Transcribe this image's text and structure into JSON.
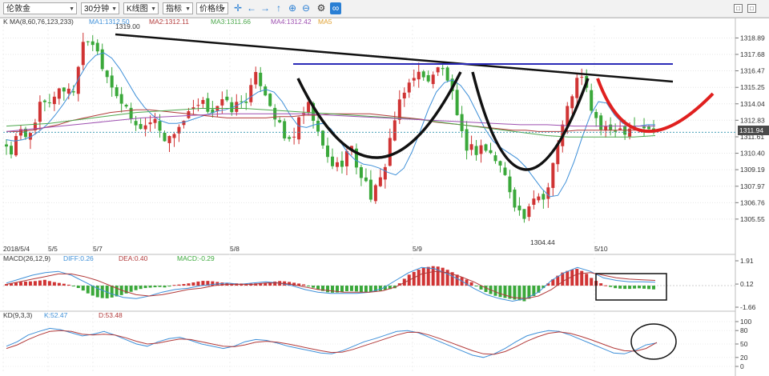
{
  "toolbar": {
    "symbol": "伦敦金",
    "period": "30分钟",
    "chart_type": "K线图",
    "indicator": "指标",
    "line_type": "价格线",
    "icons": [
      "crosshair-icon",
      "arrow-left-icon",
      "arrow-right-icon",
      "arrow-up-icon",
      "zoom-in-icon",
      "zoom-out-icon",
      "settings-icon",
      "link-icon"
    ]
  },
  "colors": {
    "up": "#d03434",
    "down": "#3aa83a",
    "ma1": "#3d8fd8",
    "ma2": "#b23a3a",
    "ma3": "#4da84d",
    "ma4": "#9d4fb0",
    "ma5": "#e0a030",
    "diff": "#3d8fd8",
    "dea": "#b23a3a",
    "k": "#3d8fd8",
    "d": "#b23a3a",
    "trend_black": "#111111",
    "resistance_blue": "#2b2bb8",
    "projection_red": "#e0201f",
    "last_price_bg": "#4a4a4a"
  },
  "main_legend": {
    "prefix": "K   MA(8,60,76,123,233)",
    "ma1": "MA1:1312.50",
    "ma2": "MA2:1312.11",
    "ma3": "MA3:1311.66",
    "ma4": "MA4:1312.42",
    "ma5": "MA5"
  },
  "macd_legend": {
    "prefix": "MACD(26,12,9)",
    "diff": "DIFF:0.26",
    "dea": "DEA:0.40",
    "macd": "MACD:-0.29"
  },
  "kd_legend": {
    "prefix": "KD(9,3,3)",
    "k": "K:52.47",
    "d": "D:53.48"
  },
  "annotations": {
    "high": "1319.00",
    "low": "1304.44",
    "last_price": "1311.94"
  },
  "chart_data": [
    {
      "type": "candlestick",
      "title": "",
      "y_ticks": [
        "1318.89",
        "1317.68",
        "1316.47",
        "1315.25",
        "1314.04",
        "1312.83",
        "1311.61",
        "1310.40",
        "1309.19",
        "1307.97",
        "1306.76",
        "1305.55"
      ],
      "ylim": [
        1304.6,
        1319.8
      ],
      "x_labels": [
        "2018/5/4",
        "5/5",
        "5/7",
        "5/8",
        "5/9",
        "5/10"
      ],
      "high_label": 1319.0,
      "low_label": 1304.44,
      "last_price": 1311.94,
      "close_path": [
        1311.0,
        1310.4,
        1311.6,
        1312.0,
        1311.2,
        1312.6,
        1313.4,
        1314.2,
        1313.6,
        1314.6,
        1315.4,
        1314.9,
        1315.3,
        1314.9,
        1317.6,
        1318.6,
        1319.0,
        1318.2,
        1317.4,
        1316.4,
        1315.6,
        1315.0,
        1314.2,
        1313.4,
        1312.8,
        1312.2,
        1312.5,
        1312.4,
        1313.0,
        1312.6,
        1311.8,
        1311.2,
        1312.0,
        1312.4,
        1312.8,
        1313.2,
        1313.6,
        1313.8,
        1314.0,
        1313.5,
        1313.8,
        1314.2,
        1314.0,
        1313.7,
        1313.9,
        1314.2,
        1314.5,
        1315.2,
        1316.2,
        1315.4,
        1314.6,
        1313.6,
        1312.6,
        1311.6,
        1311.2,
        1311.8,
        1312.6,
        1313.4,
        1313.8,
        1312.6,
        1311.4,
        1310.4,
        1309.8,
        1309.4,
        1309.6,
        1310.4,
        1310.8,
        1309.6,
        1308.8,
        1308.0,
        1307.2,
        1307.8,
        1308.6,
        1310.6,
        1312.4,
        1313.6,
        1314.6,
        1315.4,
        1316.3,
        1316.2,
        1315.8,
        1316.0,
        1316.4,
        1316.6,
        1316.4,
        1315.4,
        1313.4,
        1311.8,
        1311.0,
        1310.8,
        1310.6,
        1311.0,
        1310.6,
        1310.2,
        1309.8,
        1309.2,
        1308.2,
        1307.2,
        1306.2,
        1305.6,
        1306.0,
        1306.8,
        1307.4,
        1307.0,
        1308.6,
        1310.2,
        1311.6,
        1313.0,
        1314.4,
        1315.6,
        1316.0,
        1315.2,
        1313.8,
        1312.8,
        1312.2,
        1311.9,
        1312.2,
        1312.4,
        1312.1,
        1312.3,
        1312.6,
        1312.2,
        1312.4,
        1312.0,
        1311.9
      ],
      "ma_series": [
        {
          "name": "MA1",
          "values": [
            1311.4,
            1311.3,
            1311.4,
            1311.6,
            1312.0,
            1312.5,
            1313.2,
            1314.0,
            1314.9,
            1316.0,
            1317.0,
            1317.6,
            1317.8,
            1317.4,
            1316.6,
            1315.6,
            1314.6,
            1313.8,
            1313.2,
            1312.8,
            1312.6,
            1312.6,
            1312.7,
            1312.9,
            1313.1,
            1313.3,
            1313.5,
            1313.6,
            1313.8,
            1314.1,
            1314.5,
            1314.9,
            1315.1,
            1314.9,
            1314.2,
            1313.2,
            1312.4,
            1312.3,
            1312.5,
            1312.6,
            1312.2,
            1311.4,
            1310.5,
            1309.9,
            1309.6,
            1309.5,
            1309.3,
            1309.0,
            1308.8,
            1309.3,
            1310.5,
            1312.0,
            1313.6,
            1314.9,
            1315.6,
            1315.8,
            1315.4,
            1314.6,
            1313.4,
            1312.2,
            1311.3,
            1310.8,
            1310.4,
            1310.0,
            1309.4,
            1308.6,
            1307.8,
            1307.2,
            1307.3,
            1308.3,
            1309.8,
            1311.6,
            1313.2,
            1314.2,
            1314.1,
            1313.2,
            1312.6,
            1312.4,
            1312.4,
            1312.5,
            1312.5
          ]
        },
        {
          "name": "MA2",
          "values": [
            1312.0,
            1312.0,
            1312.1,
            1312.3,
            1312.5,
            1312.8,
            1313.0,
            1313.2,
            1313.4,
            1313.5,
            1313.6,
            1313.6,
            1313.5,
            1313.4,
            1313.3,
            1313.2,
            1313.1,
            1313.0,
            1313.0,
            1313.0,
            1313.0,
            1313.1,
            1313.1,
            1313.2,
            1313.2,
            1313.3,
            1313.3,
            1313.3,
            1313.3,
            1313.2,
            1313.1,
            1313.0,
            1312.9,
            1312.7,
            1312.6,
            1312.5,
            1312.4,
            1312.3,
            1312.2,
            1312.1,
            1312.1,
            1312.0,
            1312.0,
            1312.0,
            1312.1,
            1312.1,
            1312.1,
            1312.1,
            1312.1,
            1312.1,
            1312.1
          ]
        },
        {
          "name": "MA3",
          "values": [
            1312.4,
            1312.5,
            1312.6,
            1312.8,
            1313.0,
            1313.2,
            1313.4,
            1313.5,
            1313.6,
            1313.7,
            1313.7,
            1313.7,
            1313.6,
            1313.5,
            1313.4,
            1313.3,
            1313.2,
            1313.1,
            1313.0,
            1312.9,
            1312.7,
            1312.5,
            1312.3,
            1312.1,
            1311.9,
            1311.7,
            1311.6,
            1311.6,
            1311.6,
            1311.6,
            1311.7
          ]
        },
        {
          "name": "MA4",
          "values": [
            1312.0,
            1312.2,
            1312.4,
            1312.6,
            1312.8,
            1313.0,
            1313.1,
            1313.2,
            1313.3,
            1313.3,
            1313.3,
            1313.3,
            1313.2,
            1313.1,
            1313.0,
            1312.9,
            1312.8,
            1312.7,
            1312.6,
            1312.5,
            1312.5,
            1312.4,
            1312.4,
            1312.4,
            1312.4
          ]
        }
      ],
      "series": [
        {
          "name": "MA1",
          "value": 1312.5
        },
        {
          "name": "MA2",
          "value": 1312.11
        },
        {
          "name": "MA3",
          "value": 1311.66
        },
        {
          "name": "MA4",
          "value": 1312.42
        },
        {
          "name": "MA5"
        }
      ]
    },
    {
      "type": "bar",
      "title": "",
      "y_ticks": [
        "1.91",
        "0.12",
        "-1.66"
      ],
      "ylim": [
        -1.66,
        1.91
      ],
      "macd_hist": [
        0.12,
        0.2,
        0.3,
        0.32,
        0.36,
        0.45,
        0.3,
        0.2,
        0.1,
        -0.05,
        -0.35,
        -0.7,
        -0.9,
        -1.0,
        -0.9,
        -0.75,
        -0.55,
        -0.35,
        -0.2,
        -0.15,
        -0.1,
        -0.15,
        0.05,
        0.1,
        0.18,
        0.3,
        0.38,
        0.34,
        0.26,
        0.2,
        0.18,
        0.16,
        0.15,
        0.18,
        0.22,
        0.3,
        0.36,
        0.3,
        0.2,
        0.1,
        -0.1,
        -0.3,
        -0.5,
        -0.55,
        -0.5,
        -0.4,
        -0.45,
        -0.55,
        -0.5,
        -0.4,
        -0.3,
        -0.2,
        0.4,
        0.9,
        1.2,
        1.4,
        1.5,
        1.45,
        1.2,
        0.9,
        0.6,
        0.3,
        -0.2,
        -0.5,
        -0.75,
        -0.9,
        -1.0,
        -1.1,
        -1.2,
        -0.9,
        -0.5,
        0.1,
        0.6,
        1.0,
        1.2,
        1.3,
        1.0,
        0.5,
        0.2,
        -0.05,
        -0.2,
        -0.25,
        -0.25,
        -0.2,
        -0.25,
        -0.29
      ],
      "series": [
        {
          "name": "DIFF",
          "value": 0.26,
          "values": [
            0.2,
            0.5,
            0.8,
            1.0,
            1.1,
            0.8,
            0.3,
            -0.2,
            -0.6,
            -0.9,
            -1.0,
            -0.8,
            -0.5,
            -0.3,
            -0.2,
            0.0,
            0.1,
            0.2,
            0.1,
            0.2,
            0.3,
            0.2,
            0.0,
            -0.3,
            -0.5,
            -0.6,
            -0.6,
            -0.6,
            -0.5,
            -0.2,
            0.4,
            1.0,
            1.4,
            1.3,
            0.9,
            0.4,
            -0.2,
            -0.7,
            -1.0,
            -1.2,
            -1.0,
            -0.5,
            0.4,
            1.0,
            1.4,
            1.1,
            0.6,
            0.4,
            0.3,
            0.3,
            0.26
          ]
        },
        {
          "name": "DEA",
          "value": 0.4,
          "values": [
            0.1,
            0.3,
            0.5,
            0.7,
            0.9,
            0.9,
            0.7,
            0.4,
            0.0,
            -0.4,
            -0.7,
            -0.8,
            -0.7,
            -0.5,
            -0.3,
            -0.2,
            0.0,
            0.1,
            0.1,
            0.1,
            0.2,
            0.2,
            0.1,
            -0.1,
            -0.3,
            -0.4,
            -0.5,
            -0.5,
            -0.5,
            -0.4,
            -0.1,
            0.4,
            0.9,
            1.1,
            1.0,
            0.7,
            0.3,
            -0.2,
            -0.6,
            -0.9,
            -1.0,
            -0.8,
            -0.3,
            0.4,
            0.9,
            1.0,
            0.8,
            0.6,
            0.5,
            0.45,
            0.4
          ]
        }
      ]
    },
    {
      "type": "line",
      "title": "",
      "y_ticks": [
        "100",
        "80",
        "50",
        "20",
        "0"
      ],
      "ylim": [
        0,
        100
      ],
      "series": [
        {
          "name": "K",
          "value": 52.47,
          "values": [
            45,
            55,
            70,
            78,
            85,
            82,
            75,
            68,
            72,
            78,
            70,
            60,
            50,
            45,
            55,
            62,
            65,
            58,
            50,
            45,
            40,
            45,
            55,
            60,
            58,
            52,
            45,
            40,
            35,
            30,
            28,
            35,
            45,
            55,
            62,
            70,
            78,
            80,
            75,
            65,
            55,
            45,
            35,
            25,
            20,
            28,
            40,
            55,
            68,
            75,
            80,
            78,
            70,
            60,
            50,
            40,
            30,
            28,
            36,
            48,
            52.47
          ]
        },
        {
          "name": "D",
          "value": 53.48,
          "values": [
            40,
            48,
            60,
            70,
            78,
            80,
            78,
            72,
            70,
            72,
            70,
            64,
            56,
            50,
            52,
            57,
            61,
            60,
            55,
            50,
            45,
            44,
            48,
            54,
            56,
            54,
            50,
            45,
            40,
            35,
            31,
            32,
            38,
            46,
            54,
            62,
            70,
            76,
            76,
            70,
            62,
            53,
            44,
            35,
            28,
            27,
            33,
            44,
            56,
            66,
            74,
            77,
            74,
            67,
            59,
            50,
            41,
            35,
            34,
            40,
            53.48
          ]
        }
      ]
    }
  ]
}
